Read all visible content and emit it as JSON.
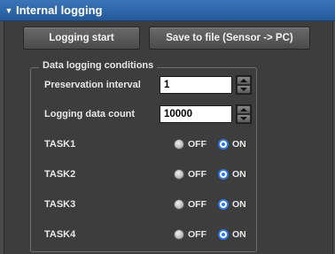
{
  "header": {
    "title": "Internal logging"
  },
  "buttons": {
    "logging_start": "Logging start",
    "save_to_file": "Save to file (Sensor -> PC)"
  },
  "conditions": {
    "legend": "Data logging conditions",
    "preservation_interval": {
      "label": "Preservation interval",
      "value": "1"
    },
    "logging_data_count": {
      "label": "Logging data count",
      "value": "10000"
    }
  },
  "tasks": [
    {
      "name": "TASK1",
      "off_label": "OFF",
      "on_label": "ON",
      "selected": "ON"
    },
    {
      "name": "TASK2",
      "off_label": "OFF",
      "on_label": "ON",
      "selected": "ON"
    },
    {
      "name": "TASK3",
      "off_label": "OFF",
      "on_label": "ON",
      "selected": "ON"
    },
    {
      "name": "TASK4",
      "off_label": "OFF",
      "on_label": "ON",
      "selected": "ON"
    }
  ]
}
